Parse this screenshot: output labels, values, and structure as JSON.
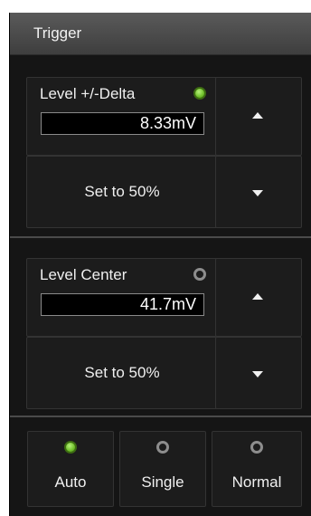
{
  "panel": {
    "title": "Trigger"
  },
  "level_delta": {
    "label": "Level +/-Delta",
    "value": "8.33mV",
    "led": "on",
    "set50_label": "Set to 50%",
    "up_icon": "triangle-up-icon",
    "down_icon": "triangle-down-icon"
  },
  "level_center": {
    "label": "Level Center",
    "value": "41.7mV",
    "led": "off",
    "set50_label": "Set to 50%",
    "up_icon": "triangle-up-icon",
    "down_icon": "triangle-down-icon"
  },
  "modes": [
    {
      "label": "Auto",
      "selected": true
    },
    {
      "label": "Single",
      "selected": false
    },
    {
      "label": "Normal",
      "selected": false
    }
  ],
  "colors": {
    "led_on": "#6fc02a",
    "led_off": "#8d8d8d",
    "panel_bg": "#151515",
    "header_bg": "#4a4a4a"
  }
}
